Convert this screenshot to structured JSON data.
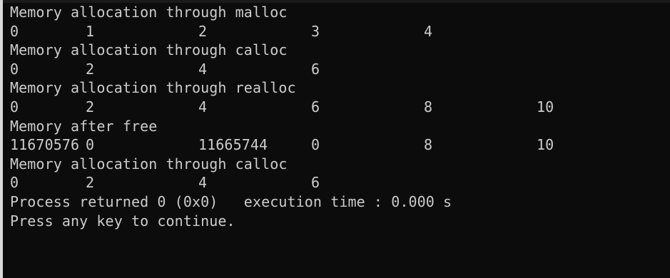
{
  "console": {
    "lines": [
      {
        "type": "text",
        "text": "Memory allocation through malloc"
      },
      {
        "type": "row",
        "cells": [
          "0",
          "1",
          "2",
          "3",
          "4"
        ]
      },
      {
        "type": "text",
        "text": "Memory allocation through calloc"
      },
      {
        "type": "row",
        "cells": [
          "0",
          "2",
          "4",
          "6"
        ]
      },
      {
        "type": "text",
        "text": "Memory allocation through realloc"
      },
      {
        "type": "row",
        "cells": [
          "0",
          "2",
          "4",
          "6",
          "8",
          "10"
        ]
      },
      {
        "type": "text",
        "text": "Memory after free"
      },
      {
        "type": "row",
        "cells": [
          "11670576",
          "0",
          "11665744",
          "0",
          "8",
          "10"
        ]
      },
      {
        "type": "text",
        "text": "Memory allocation through calloc"
      },
      {
        "type": "row",
        "cells": [
          "0",
          "2",
          "4",
          "6"
        ]
      },
      {
        "type": "text",
        "text": "Process returned 0 (0x0)   execution time : 0.000 s"
      },
      {
        "type": "text",
        "text": "Press any key to continue."
      }
    ]
  },
  "colors": {
    "background": "#0c0c0c",
    "text": "#cccccc"
  }
}
